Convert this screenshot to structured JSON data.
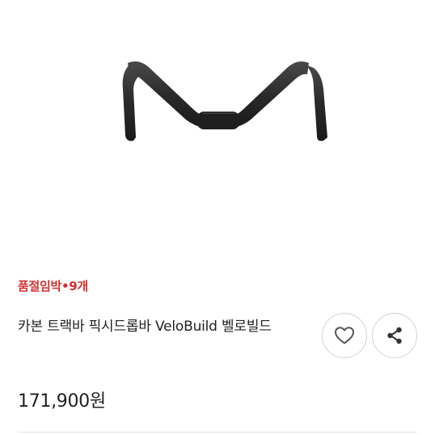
{
  "product": {
    "image_alt": "carbon track handlebar",
    "status": "품절임박•9개",
    "title": "카본 트랙바 픽시드롭바 VeloBuild 벨로빌드",
    "price": "171,900원"
  },
  "actions": {
    "like_icon": "heart-outline-icon",
    "share_icon": "share-icon"
  },
  "colors": {
    "status": "#d32f2f",
    "handlebar": "#2b2b2b",
    "button_border": "#d4d4d4"
  }
}
